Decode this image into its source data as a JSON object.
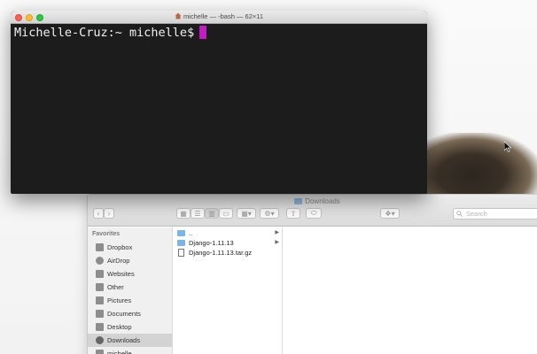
{
  "terminal": {
    "title": "michelle — -bash — 62×11",
    "prompt": "Michelle-Cruz:~ michelle$",
    "cursor_color": "#c41cc4"
  },
  "finder": {
    "title": "Downloads",
    "search_placeholder": "Search",
    "sidebar": {
      "heading": "Favorites",
      "items": [
        {
          "label": "Dropbox",
          "icon": "dropbox-icon"
        },
        {
          "label": "AirDrop",
          "icon": "airdrop-icon"
        },
        {
          "label": "Websites",
          "icon": "folder-icon"
        },
        {
          "label": "Other",
          "icon": "folder-icon"
        },
        {
          "label": "Pictures",
          "icon": "camera-icon"
        },
        {
          "label": "Documents",
          "icon": "document-icon"
        },
        {
          "label": "Desktop",
          "icon": "desktop-icon"
        },
        {
          "label": "Downloads",
          "icon": "download-icon",
          "selected": true
        },
        {
          "label": "michelle",
          "icon": "home-icon"
        }
      ]
    },
    "files": [
      {
        "name": "..",
        "type": "folder"
      },
      {
        "name": "Django-1.11.13",
        "type": "folder"
      },
      {
        "name": "Django-1.11.13.tar.gz",
        "type": "file"
      }
    ]
  }
}
